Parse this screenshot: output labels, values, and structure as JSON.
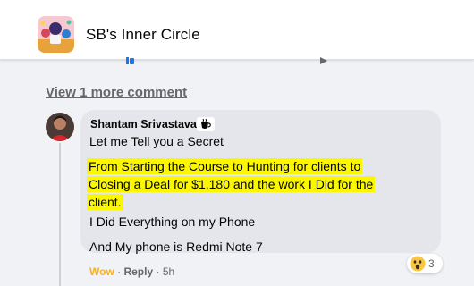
{
  "header": {
    "group_name": "SB's Inner Circle"
  },
  "comments": {
    "view_more": "View 1 more comment"
  },
  "comment": {
    "author": "Shantam Srivastava",
    "badge_icon": "coffee-cup-icon",
    "lines": {
      "intro": "Let me Tell you a Secret",
      "highlight": "From Starting the Course to Hunting for clients to Closing a Deal for $1,180 and the work I Did for the client.",
      "line3": "I Did Everything on my Phone",
      "line4": "And My phone is Redmi Note 7"
    },
    "reactions": {
      "icon": "wow-emoji-icon",
      "count": "3"
    },
    "actions": {
      "reaction_label": "Wow",
      "separator1": " · ",
      "reply_label": "Reply",
      "separator2": " · ",
      "time": "5h"
    }
  },
  "colors": {
    "highlight": "#fbf700",
    "wow": "#f7b125",
    "muted": "#65676b",
    "bubble": "#e4e6eb"
  }
}
